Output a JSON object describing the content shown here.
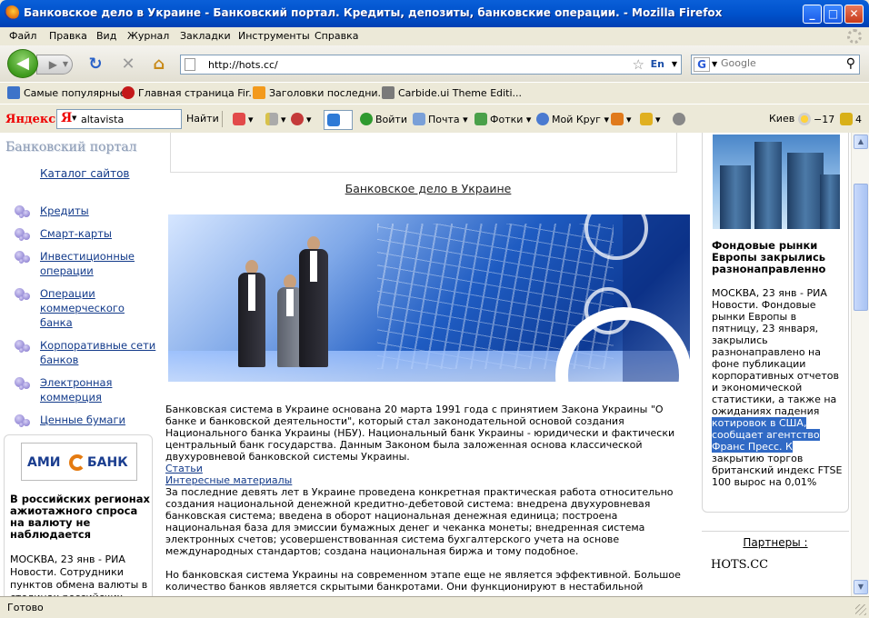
{
  "window": {
    "title": "Банковское дело в Украине - Банковский портал. Кредиты, депозиты, банковские операции. - Mozilla Firefox",
    "minimize": "_",
    "maximize": "□",
    "close": "✕"
  },
  "menu": [
    "Файл",
    "Правка",
    "Вид",
    "Журнал",
    "Закладки",
    "Инструменты",
    "Справка"
  ],
  "nav": {
    "url": "http://hots.cc/",
    "lang": "En",
    "search_placeholder": "Google"
  },
  "bookmarks": [
    "Самые популярные",
    "Главная страница Fir...",
    "Заголовки последни...",
    "Carbide.ui Theme Editi..."
  ],
  "yandex": {
    "logo": "Яндекс",
    "query": "altavista",
    "find": "Найти",
    "login": "Войти",
    "mail": "Почта",
    "photos": "Фотки",
    "circle": "Мой Круг",
    "city": "Киев",
    "temp": "−17",
    "count": "4"
  },
  "left": {
    "site_title": "Банковский портал",
    "catalog": "Каталог сайтов",
    "nav": [
      "Кредиты",
      "Смарт-карты",
      "Инвестиционные операции",
      "Операции коммерческого банка",
      "Корпоративные сети банков",
      "Электронная коммерция",
      "Ценные бумаги"
    ],
    "bank_logo_left": "АМИ",
    "bank_logo_right": "БАНК",
    "news_title": "В российских регионах ажиотажного спроса на валюту не наблюдается",
    "news_text": "МОСКВА, 23 янв - РИА Новости. Сотрудники пунктов обмена валюты в столицах российских"
  },
  "center": {
    "title": "Банковское дело в Украине",
    "para1": "Банковская система в Украине основана 20 марта 1991 года с принятием Закона Украины \"О банке и банковской деятельности\", который стал законодательной основой создания Национального банка Украины (НБУ). Национальный банк Украины - юридически и фактически центральный банк государства. Данным Законом была заложенная основа классической двухуровневой банковской системы Украины.",
    "link1": "Статьи",
    "link2": "Интересные материалы",
    "para2": "За последние девять лет в Украине проведена конкретная практическая работа относительно создания национальной денежной кредитно-дебетовой система: внедрена двухуровневая банковская система; введена в оборот национальная денежная единица; построена национальная база для эмиссии бумажных денег и чеканка монеты; внедренная система электронных счетов; усовершенствованная система бухгалтерского учета на основе международных стандартов; создана национальная биржа и тому подобное.",
    "para3": "Но банковская система Украины на современном этапе еще не является эффективной. Большое количество банков является скрытыми банкротами. Они функционируют в нестабильной"
  },
  "right": {
    "news_title": "Фондовые рынки Европы закрылись разнонаправленно",
    "news_text_before": "МОСКВА, 23 янв - РИА Новости. Фондовые рынки Европы в пятницу, 23 января, закрылись разнонаправлено на фоне публикации корпоративных отчетов и экономической статистики, а также на ожиданиях падения ",
    "news_text_highlight": "котировок в США, сообщает агентство Франс Пресс. К",
    "news_text_after": " закрытию торгов британский индекс FTSE 100 вырос на 0,01%",
    "partners": "Партнеры :",
    "partner1": "HOTS.CC"
  },
  "status": "Готово",
  "colors": {
    "titlebar": "#0052cc",
    "link": "#123a8a",
    "highlight": "#316ac5"
  }
}
